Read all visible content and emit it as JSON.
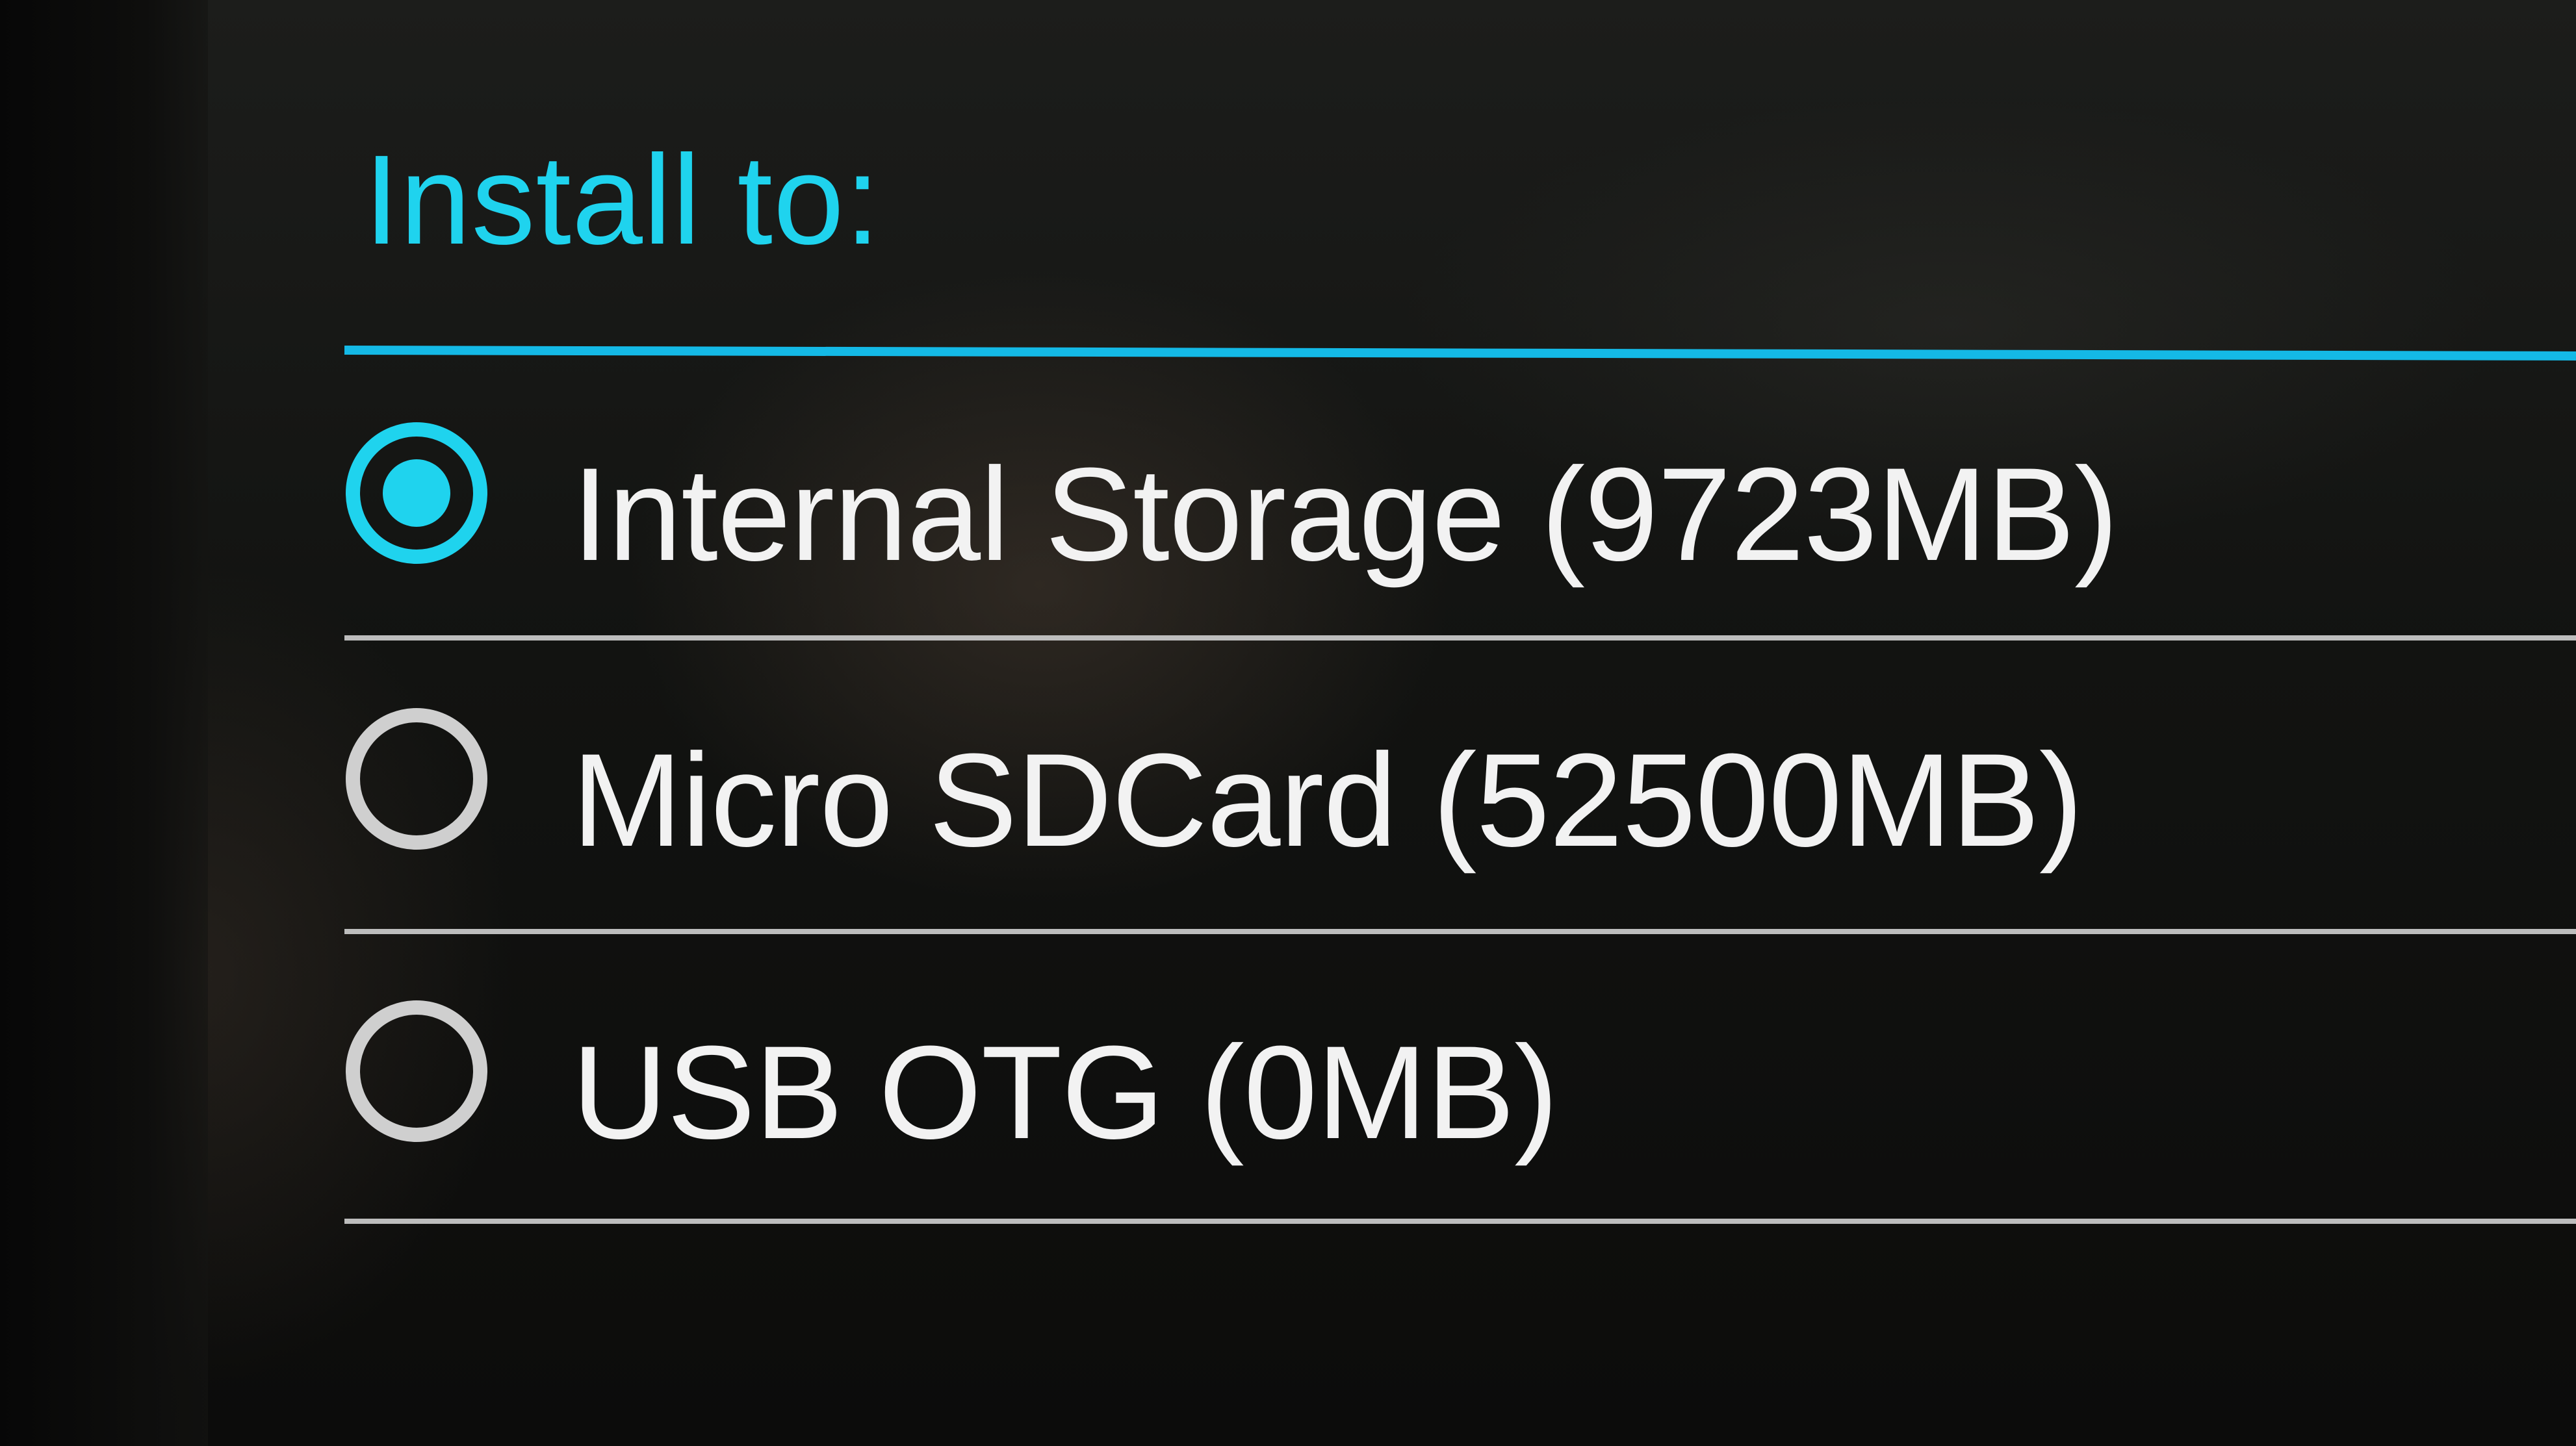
{
  "dialog": {
    "title": "Install to:",
    "options": [
      {
        "label": "Internal Storage (9723MB)",
        "selected": true
      },
      {
        "label": "Micro SDCard (52500MB)",
        "selected": false
      },
      {
        "label": "USB OTG (0MB)",
        "selected": false
      }
    ]
  },
  "colors": {
    "accent": "#1fd3ee",
    "text": "#f2f2f2",
    "divider": "#bdbdbd",
    "background": "#121311"
  }
}
